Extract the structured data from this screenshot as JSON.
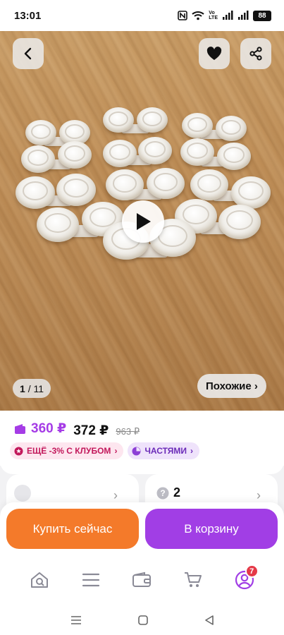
{
  "status_bar": {
    "time": "13:01",
    "lte_top": "Vo",
    "lte_bottom": "LTE",
    "battery": "88"
  },
  "gallery": {
    "counter_current": "1",
    "counter_total": "/ 11",
    "similar_label": "Похожие ›"
  },
  "price": {
    "wallet_price": "360 ₽",
    "price": "372 ₽",
    "old_price": "963 ₽"
  },
  "badges": {
    "club": "ЕЩЁ -3% С КЛУБОМ",
    "parts": "ЧАСТЯМИ"
  },
  "info": {
    "questions_count": "2"
  },
  "actions": {
    "buy_now": "Купить сейчас",
    "add_to_cart": "В корзину"
  },
  "tabbar": {
    "profile_badge": "7"
  },
  "colors": {
    "accent_purple": "#a13ee5",
    "accent_orange": "#f47a2a",
    "club_pink": "#c2185b"
  }
}
